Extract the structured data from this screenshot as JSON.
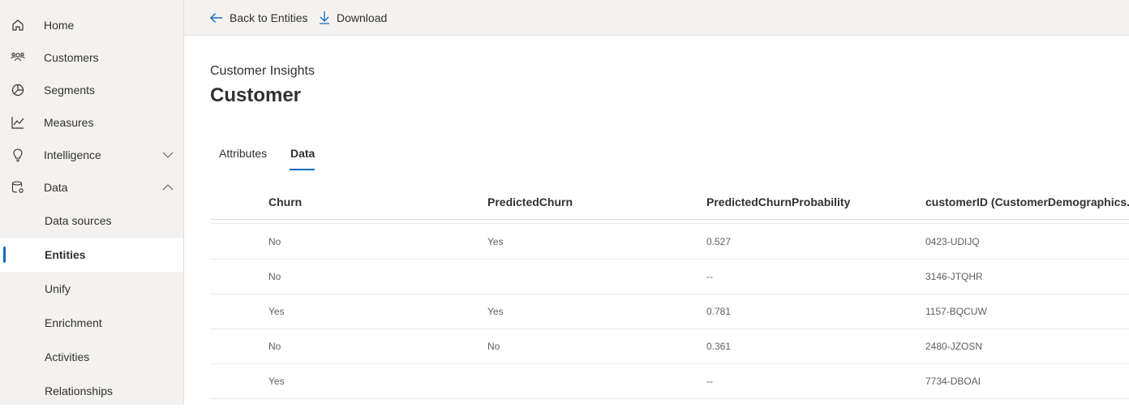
{
  "sidebar": {
    "items": [
      {
        "label": "Home",
        "icon": "home-icon"
      },
      {
        "label": "Customers",
        "icon": "customers-icon"
      },
      {
        "label": "Segments",
        "icon": "segments-icon"
      },
      {
        "label": "Measures",
        "icon": "measures-icon"
      },
      {
        "label": "Intelligence",
        "icon": "lightbulb-icon",
        "chevron": "down"
      },
      {
        "label": "Data",
        "icon": "data-icon",
        "chevron": "up"
      }
    ],
    "subitems": [
      {
        "label": "Data sources"
      },
      {
        "label": "Entities",
        "selected": true
      },
      {
        "label": "Unify"
      },
      {
        "label": "Enrichment"
      },
      {
        "label": "Activities"
      },
      {
        "label": "Relationships"
      }
    ]
  },
  "commandbar": {
    "back_label": "Back to Entities",
    "download_label": "Download"
  },
  "header": {
    "eyebrow": "Customer Insights",
    "title": "Customer"
  },
  "tabs": [
    {
      "label": "Attributes",
      "active": false
    },
    {
      "label": "Data",
      "active": true
    }
  ],
  "table": {
    "columns": [
      "Churn",
      "PredictedChurn",
      "PredictedChurnProbability",
      "customerID (CustomerDemographics..."
    ],
    "rows": [
      [
        "No",
        "Yes",
        "0.527",
        "0423-UDIJQ"
      ],
      [
        "No",
        "",
        "--",
        "3146-JTQHR"
      ],
      [
        "Yes",
        "Yes",
        "0.781",
        "1157-BQCUW"
      ],
      [
        "No",
        "No",
        "0.361",
        "2480-JZOSN"
      ],
      [
        "Yes",
        "",
        "--",
        "7734-DBOAI"
      ]
    ]
  },
  "colors": {
    "accent": "#0f6cbd",
    "sidebar_bg": "#f3f2f1"
  }
}
